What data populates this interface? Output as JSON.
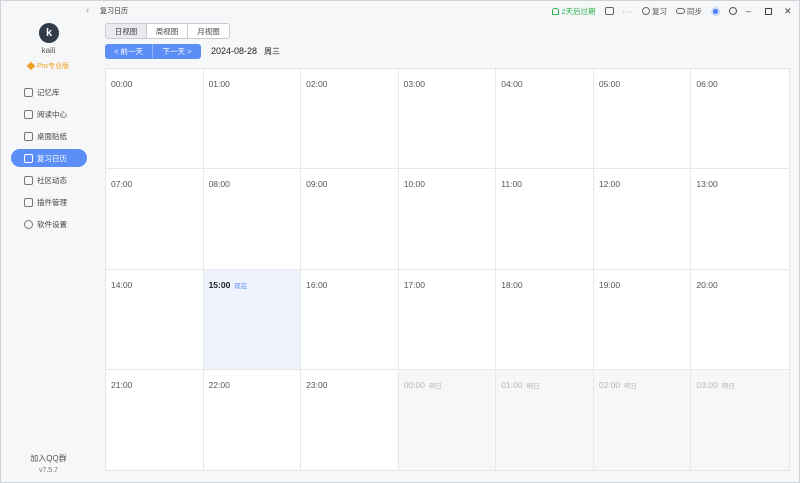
{
  "sidebar": {
    "avatar_letter": "k",
    "username": "kaili",
    "pro_label": "Pro专业版",
    "items": [
      {
        "label": "记忆库",
        "icon": "memory-icon"
      },
      {
        "label": "阅读中心",
        "icon": "reading-icon"
      },
      {
        "label": "桌面贴纸",
        "icon": "sticker-icon"
      },
      {
        "label": "复习日历",
        "icon": "calendar-icon",
        "active": true
      },
      {
        "label": "社区动态",
        "icon": "community-icon"
      },
      {
        "label": "插件管理",
        "icon": "plugin-icon"
      },
      {
        "label": "软件设置",
        "icon": "settings-icon"
      }
    ],
    "qq_group": "加入QQ群",
    "version": "v7.5.7"
  },
  "topbar": {
    "page_title": "复习日历",
    "expire_text": "2天后过期",
    "review_label": "复习",
    "sync_label": "同步"
  },
  "view_tabs": [
    "日视图",
    "周视图",
    "月视图"
  ],
  "active_view": "日视图",
  "date_nav": {
    "prev_label": "< 前一天",
    "next_label": "下一天 >",
    "date": "2024-08-28",
    "weekday": "周三"
  },
  "calendar": {
    "cells": [
      {
        "time": "00:00"
      },
      {
        "time": "01:00"
      },
      {
        "time": "02:00"
      },
      {
        "time": "03:00"
      },
      {
        "time": "04:00"
      },
      {
        "time": "05:00"
      },
      {
        "time": "06:00"
      },
      {
        "time": "07:00"
      },
      {
        "time": "08:00"
      },
      {
        "time": "09:00"
      },
      {
        "time": "10:00"
      },
      {
        "time": "11:00"
      },
      {
        "time": "12:00"
      },
      {
        "time": "13:00"
      },
      {
        "time": "14:00"
      },
      {
        "time": "15:00",
        "tag": "现在",
        "state": "now"
      },
      {
        "time": "16:00"
      },
      {
        "time": "17:00"
      },
      {
        "time": "18:00"
      },
      {
        "time": "19:00"
      },
      {
        "time": "20:00"
      },
      {
        "time": "21:00"
      },
      {
        "time": "22:00"
      },
      {
        "time": "23:00"
      },
      {
        "time": "00:00",
        "tag": "明日",
        "state": "next"
      },
      {
        "time": "01:00",
        "tag": "明日",
        "state": "next"
      },
      {
        "time": "02:00",
        "tag": "明日",
        "state": "next"
      },
      {
        "time": "03:00",
        "tag": "明日",
        "state": "next"
      }
    ]
  },
  "colors": {
    "accent": "#5b8ef7",
    "expire": "#2bb24c",
    "pro": "#f0a020"
  }
}
